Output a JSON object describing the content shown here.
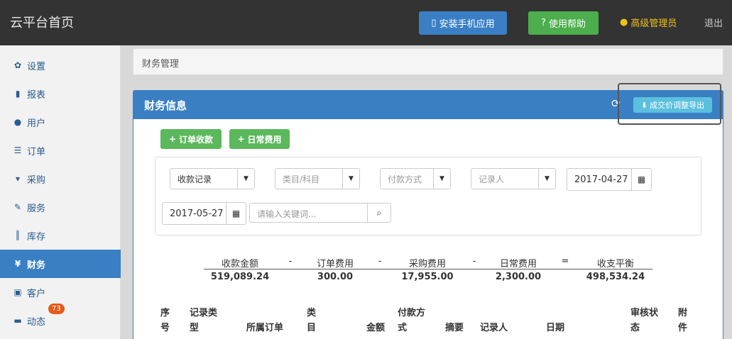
{
  "header": {
    "brand": "云平台首页",
    "install_app": "安装手机应用",
    "help": "使用帮助",
    "admin": "高级管理员",
    "logout": "退出"
  },
  "sidebar": {
    "items": [
      {
        "label": "设置",
        "icon": "gear-icon"
      },
      {
        "label": "报表",
        "icon": "bar-chart-icon"
      },
      {
        "label": "用户",
        "icon": "user-icon"
      },
      {
        "label": "订单",
        "icon": "list-icon"
      },
      {
        "label": "采购",
        "icon": "cart-icon"
      },
      {
        "label": "服务",
        "icon": "wrench-icon"
      },
      {
        "label": "库存",
        "icon": "barcode-icon"
      },
      {
        "label": "财务",
        "icon": "yen-icon"
      },
      {
        "label": "客户",
        "icon": "briefcase-icon"
      },
      {
        "label": "动态",
        "icon": "comment-icon"
      }
    ],
    "active": "财务",
    "badge": "73"
  },
  "breadcrumb": "财务管理",
  "panel": {
    "title": "财务信息",
    "export": "成交价调整导出"
  },
  "actions": {
    "order_receipt": "订单收款",
    "daily_expense": "日常费用"
  },
  "filters": {
    "record_type": "收款记录",
    "category": "类目/科目",
    "payment_method": "付款方式",
    "recorder": "记录人",
    "start_date": "2017-04-27",
    "end_date": "2017-05-27",
    "search_placeholder": "请输入关键词..."
  },
  "summary": {
    "labels": [
      "收款金额",
      "订单费用",
      "采购费用",
      "日常费用",
      "收支平衡"
    ],
    "values": [
      "519,089.24",
      "300.00",
      "17,955.00",
      "2,300.00",
      "498,534.24"
    ],
    "ops": [
      "-",
      "-",
      "-",
      "="
    ]
  },
  "table": {
    "headers": [
      "序号",
      "记录类型",
      "所属订单",
      "类目",
      "金额",
      "付款方式",
      "摘要",
      "记录人",
      "日期",
      "审核状态",
      "附件"
    ]
  },
  "colors": {
    "primary": "#3a7fc4",
    "success": "#5cb85c",
    "info": "#5bc0de",
    "admin": "#f0c21a",
    "badge": "#e55b1a"
  }
}
